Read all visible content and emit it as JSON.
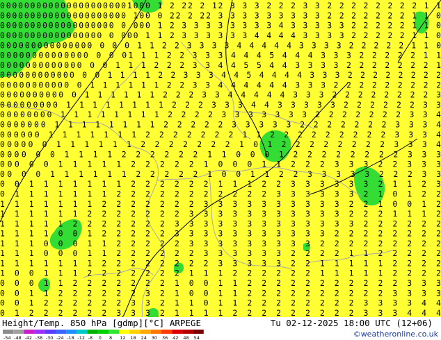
{
  "footer": {
    "title": "Height/Temp. 850 hPa [gdmp][°C] ARPEGE",
    "datetime": "Tu 02-12-2025 18:00 UTC (12+06)",
    "credit": "©weatheronline.co.uk"
  },
  "colorbar": {
    "tick_labels": [
      "-54",
      "-48",
      "-42",
      "-38",
      "-30",
      "-24",
      "-18",
      "-12",
      "-8",
      "0",
      "8",
      "12",
      "18",
      "24",
      "30",
      "36",
      "42",
      "48",
      "54"
    ],
    "colors": [
      "#8c8c8c",
      "#a0a0a0",
      "#c81ec8",
      "#9b30ff",
      "#5a3cff",
      "#3c64ff",
      "#1e90ff",
      "#00c8c8",
      "#00b400",
      "#00d200",
      "#32e632",
      "#ffff00",
      "#ffd200",
      "#ffaa00",
      "#ff7800",
      "#ff3c00",
      "#dc0000",
      "#b40000",
      "#7a0000"
    ]
  },
  "map": {
    "background_color": "#ffff33",
    "cold_region_color": "#33dd33",
    "contour_color": "#000000",
    "border_color": "#aaaaaa",
    "number_rows": [
      "0000000000000000000001000 1 2 22 2 12 3 3 3 2 2 2 3 3 2 2 2 2 2 2 2 2 1 1",
      "000000000000000000000 100 0 22 2 22 3 3 3 3 3 3 3 3 3 2 2 2 2 2 2 2 1 1 0",
      "0000000000000000000 0 000 1 2 3 3 3 3 3 3 3 3 4 3 3 3 3 3 2 2 2 2 2 1 1 0",
      "00000000000000000 0 000 1 1 2 3 3 3 3 3 3 4 4 4 4 3 3 3 3 2 2 2 2 2 1 1 0",
      "000000000000000 0 0 0 1 1 2 2 3 3 3 3 4 4 4 4 4 3 3 3 3 2 2 2 2 2 1 1 0",
      "00000000000000 0 0 01 1 1 2 2 3 3 3 4 4 4 5 4 4 4 3 3 3 2 2 2 2 2 1 1",
      "0000000000000 0 0 1 1 1 2 2 2 3 3 4 4 5 5 4 4 3 3 3 3 2 2 2 2 2 2 2 1",
      "000000000000 0 0 1 1 1 1 2 2 3 3 3 4 4 5 4 4 4 4 3 3 3 2 2 2 2 2 2 2 2",
      "00000000000 0 1 1 1 1 1 1 2 2 3 3 4 4 4 4 4 4 3 3 3 2 2 2 2 2 2 2 2 2",
      "0000000000 0 1 1 1 1 1 1 2 2 2 3 3 4 4 4 4 4 3 3 3 2 2 2 2 2 2 2 2 3",
      "000000000 1 1 1 1 1 1 1 1 2 2 2 3 3 3 4 4 3 3 3 3 3 2 2 2 2 2 2 3 3",
      "00000000 1 1 1 1 1 1 1 1 2 2 2 2 3 3 3 3 3 3 3 2 2 2 2 2 2 2 3 3 4",
      "0000000 1 1 1 1 1 1 1 1 2 2 2 2 2 3 3 3 3 3 2 2 2 2 2 2 2 3 3 3 4",
      "000000 1 1 1 1 1 1 1 2 2 2 2 2 2 2 1 1 2 2 2 2 2 2 2 2 2 3 3 3 4",
      "00000 0 1 1 1 1 1 1 2 2 2 2 2 2 2 1 0 1 2 2 2 2 2 2 2 2 3 3 3 4",
      "0000 0 0 1 1 1 1 2 2 2 2 2 2 1 1 0 0 0 1 2 2 2 2 2 2 2 2 3 3 3",
      "000 0 0 1 1 1 1 1 2 2 2 2 2 1 0 0 0 1 1 2 2 2 3 3 3 2 2 3 3 3",
      "00 0 0 1 1 1 1 1 1 2 2 2 2 2 1 0 0 1 1 2 2 3 3 3 3 3 2 2 2 3 3",
      "0 0 1 1 1 1 1 1 1 2 2 2 2 2 2 1 1 1 2 2 3 3 3 3 3 3 2 1 1 2 3",
      "0 1 1 1 1 1 1 1 2 2 2 2 2 2 2 2 2 2 2 3 3 3 3 3 3 2 1 0 1 2 2",
      "1 1 1 1 1 1 1 2 2 2 2 2 2 2 3 3 3 3 3 3 3 3 3 3 2 2 1 0 0 1 2",
      "1 1 1 1 1 1 2 2 2 2 2 2 2 3 3 3 3 3 3 3 3 3 3 3 2 2 2 1 1 1 2",
      "1 1 1 1 1 2 2 2 2 2 2 2 3 3 3 3 3 3 3 3 3 3 3 3 3 2 2 2 2 2 2",
      "1 1 1 1 0 0 1 2 2 2 2 2 3 3 3 3 3 3 3 3 3 3 3 2 2 2 2 2 2 2 2",
      "1 1 1 0 0 0 1 1 2 2 2 2 2 3 3 3 3 3 3 3 3 3 2 2 2 2 2 2 2 2 2",
      "1 1 1 0 0 0 1 1 2 2 2 2 2 2 3 3 3 3 3 3 2 2 2 2 1 1 2 2 2 2 2",
      "1 1 1 1 1 1 1 2 2 2 2 2 2 2 2 3 3 3 3 3 2 2 1 1 1 1 1 2 2 2 2",
      "1 0 0 1 1 1 2 2 2 2 2 2 2 1 1 1 2 2 2 2 2 2 1 1 1 1 1 2 2 2 2",
      "0 0 0 1 1 2 2 2 2 2 2 2 1 0 0 1 1 2 2 2 2 2 2 2 2 2 2 2 3 3 3",
      "0 0 1 1 2 2 2 2 2 2 3 2 1 0 0 1 1 2 2 2 2 2 2 2 2 2 2 3 3 3 3",
      "0 0 1 2 2 2 2 2 2 3 3 2 1 1 0 1 1 2 2 2 2 2 2 2 2 3 3 3 3 4 4",
      "0 1 2 2 2 2 2 2 3 3 3 2 1 1 1 1 2 2 2 2 2 2 2 2 2 3 3 3 4 4 4"
    ]
  }
}
